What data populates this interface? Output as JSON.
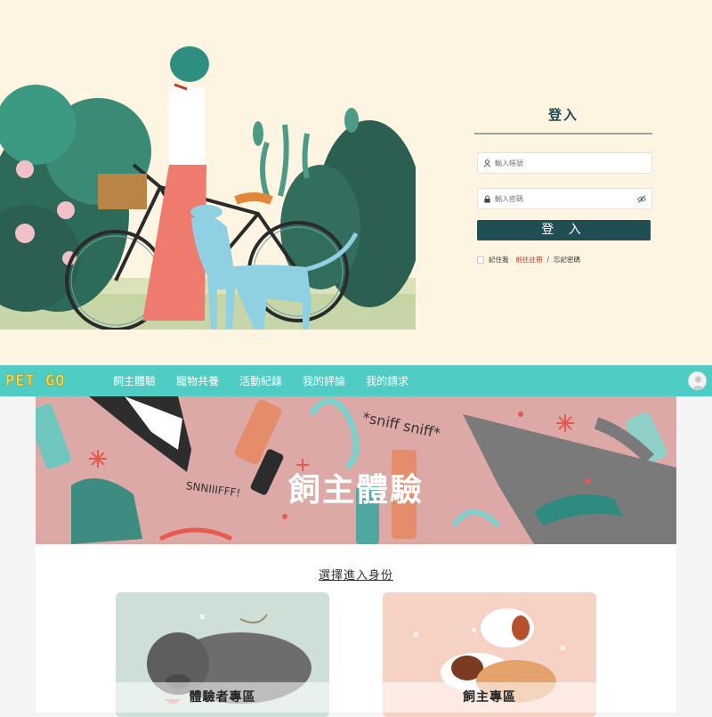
{
  "login": {
    "title": "登入",
    "username_placeholder": "輸入帳號",
    "password_placeholder": "輸入密碼",
    "submit_label": "登 入",
    "remember_label": "記住我",
    "register_label": "前往註冊",
    "separator": "/",
    "forgot_label": "忘記密碼"
  },
  "nav": {
    "logo": "PET GO",
    "items": [
      "飼主體驗",
      "寵物共養",
      "活動紀錄",
      "我的評論",
      "我的請求"
    ]
  },
  "banner": {
    "title": "飼主體驗",
    "sniff_text": "*sniff sniff*",
    "snif_text": "SNNIIIFFF!"
  },
  "main": {
    "heading": "選擇進入身份",
    "cards": [
      {
        "label": "體驗者專區"
      },
      {
        "label": "飼主專區"
      }
    ]
  },
  "colors": {
    "cream": "#fdf5e2",
    "teal_dark": "#1f4e53",
    "nav_teal": "#4fccc3",
    "banner_pink": "#dca9a6",
    "logo_yellow": "#f1e24c"
  }
}
